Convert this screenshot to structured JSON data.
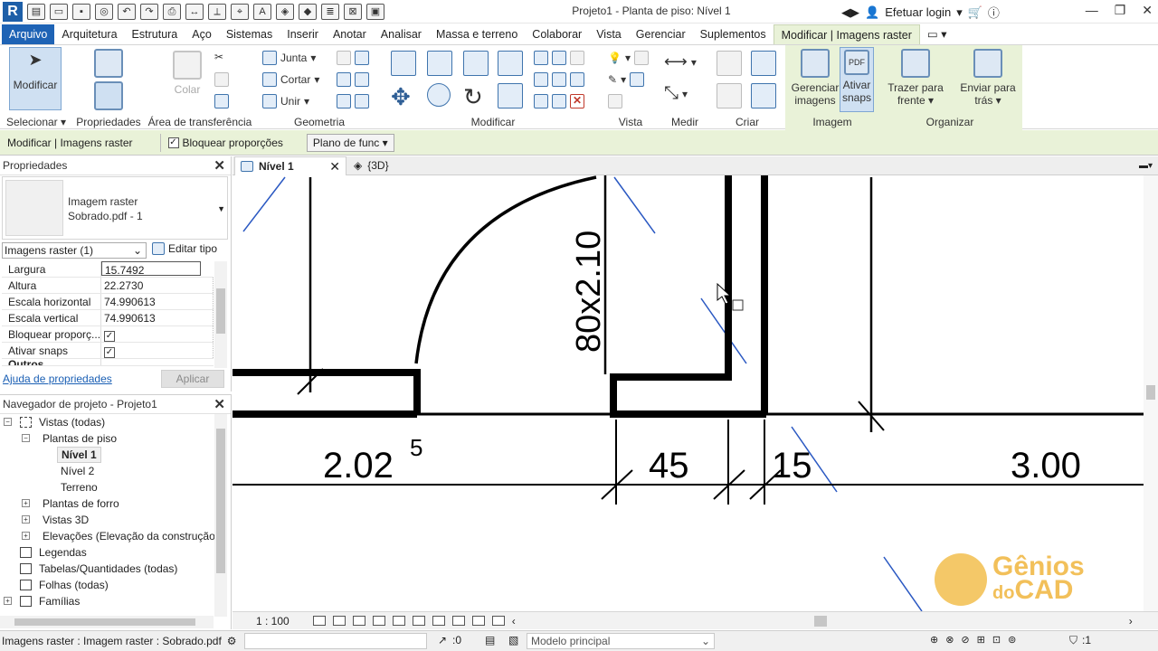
{
  "app": {
    "title": "Projeto1 - Planta de piso: Nível 1",
    "login": "Efetuar login"
  },
  "menu": {
    "file": "Arquivo",
    "tabs": [
      "Arquitetura",
      "Estrutura",
      "Aço",
      "Sistemas",
      "Inserir",
      "Anotar",
      "Analisar",
      "Massa e terreno",
      "Colaborar",
      "Vista",
      "Gerenciar",
      "Suplementos"
    ],
    "context_tab": "Modificar | Imagens raster"
  },
  "ribbon": {
    "selecionar": {
      "modify": "Modificar",
      "label": "Selecionar"
    },
    "propriedades": {
      "label": "Propriedades"
    },
    "clipboard": {
      "paste": "Colar",
      "label": "Área de transferência"
    },
    "geometria": {
      "join": "Junta",
      "cut": "Cortar",
      "unite": "Unir",
      "label": "Geometria"
    },
    "modificar": {
      "label": "Modificar"
    },
    "vista": {
      "label": "Vista"
    },
    "medir": {
      "label": "Medir"
    },
    "criar": {
      "label": "Criar"
    },
    "imagem": {
      "manage": "Gerenciar imagens",
      "snaps": "Ativar snaps",
      "label": "Imagem"
    },
    "organizar": {
      "front": "Trazer para frente",
      "back": "Enviar para trás",
      "label": "Organizar"
    }
  },
  "options_bar": {
    "context": "Modificar | Imagens raster",
    "lock_proportions": "Bloquear proporções",
    "plane": "Plano de func"
  },
  "properties": {
    "title": "Propriedades",
    "type_name": "Imagem raster",
    "type_sub": "Sobrado.pdf - 1",
    "instance_selector": "Imagens raster (1)",
    "edit_type": "Editar tipo",
    "rows": [
      {
        "name": "Largura",
        "value": "15.7492"
      },
      {
        "name": "Altura",
        "value": "22.2730"
      },
      {
        "name": "Escala horizontal",
        "value": "74.990613"
      },
      {
        "name": "Escala vertical",
        "value": "74.990613"
      },
      {
        "name": "Bloquear proporç...",
        "value": "✓"
      },
      {
        "name": "Ativar snaps",
        "value": "✓"
      },
      {
        "name": "Outros",
        "value": ""
      }
    ],
    "help": "Ajuda de propriedades",
    "apply": "Aplicar"
  },
  "browser": {
    "title": "Navegador de projeto - Projeto1",
    "nodes": [
      {
        "label": "Vistas (todas)",
        "toggle": "−"
      },
      {
        "label": "Plantas de piso",
        "toggle": "−"
      },
      {
        "label": "Nível 1",
        "toggle": ""
      },
      {
        "label": "Nível 2",
        "toggle": ""
      },
      {
        "label": "Terreno",
        "toggle": ""
      },
      {
        "label": "Plantas de forro",
        "toggle": "+"
      },
      {
        "label": "Vistas 3D",
        "toggle": "+"
      },
      {
        "label": "Elevações (Elevação da construção)",
        "toggle": "+"
      },
      {
        "label": "Legendas",
        "toggle": ""
      },
      {
        "label": "Tabelas/Quantidades (todas)",
        "toggle": ""
      },
      {
        "label": "Folhas (todas)",
        "toggle": ""
      },
      {
        "label": "Famílias",
        "toggle": "+"
      }
    ]
  },
  "view_tabs": [
    {
      "label": "Nível 1"
    },
    {
      "label": "{3D}"
    }
  ],
  "drawing": {
    "dim1": "2.02",
    "dim1_sup": "5",
    "dim2": "45",
    "dim3": "15",
    "dim4": "3.00",
    "door_label": "80x2.10"
  },
  "view_control": {
    "scale": "1 : 100"
  },
  "status": {
    "selection": "Imagens raster : Imagem raster : Sobrado.pdf",
    "zero": ":0",
    "model": "Modelo principal",
    "filter": ":1"
  },
  "watermark": {
    "line1": "Gênios",
    "line2a": "do",
    "line2b": "CAD"
  }
}
